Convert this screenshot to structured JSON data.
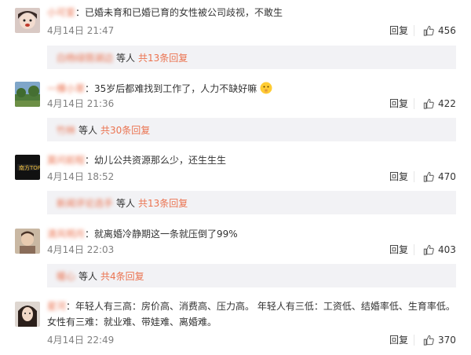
{
  "comments": [
    {
      "name": "小可爱",
      "text": "已婚未育和已婚已育的女性被公司歧视，不敢生",
      "date": "4月14日 21:47",
      "reply_label": "回复",
      "likes": "456",
      "sub_users": "白杨绿荫湖边",
      "sub_suffix": "等人",
      "sub_link": "共13条回复"
    },
    {
      "name": "一棵小草",
      "text": "35岁后都难找到工作了，人力不缺好嘛",
      "date": "4月14日 21:36",
      "reply_label": "回复",
      "likes": "422",
      "sub_users": "竹林",
      "sub_suffix": "等人",
      "sub_link": "共30条回复"
    },
    {
      "name": "莫问前程",
      "text": "幼儿公共资源那么少，还生生生",
      "date": "4月14日 18:52",
      "reply_label": "回复",
      "likes": "470",
      "sub_users": "新闻评论选手",
      "sub_suffix": "等人",
      "sub_link": "共13条回复"
    },
    {
      "name": "清风明月",
      "text": "就离婚冷静期这一条就压倒了99%",
      "date": "4月14日 22:03",
      "reply_label": "回复",
      "likes": "403",
      "sub_users": "暖心",
      "sub_suffix": "等人",
      "sub_link": "共4条回复"
    },
    {
      "name": "星河",
      "text": "年轻人有三高：房价高、消费高、压力高。 年轻人有三低：工资低、结婚率低、生育率低。 女性有三难：就业难、带娃难、离婚难。",
      "date": "4月14日 22:49",
      "reply_label": "回复",
      "likes": "370"
    }
  ],
  "icons": {
    "like": "thumbs-up-icon",
    "emoji": "shushing-face-emoji"
  },
  "colors": {
    "link": "#eb7350",
    "muted": "#808080",
    "sub_bg": "#f2f2f5"
  }
}
